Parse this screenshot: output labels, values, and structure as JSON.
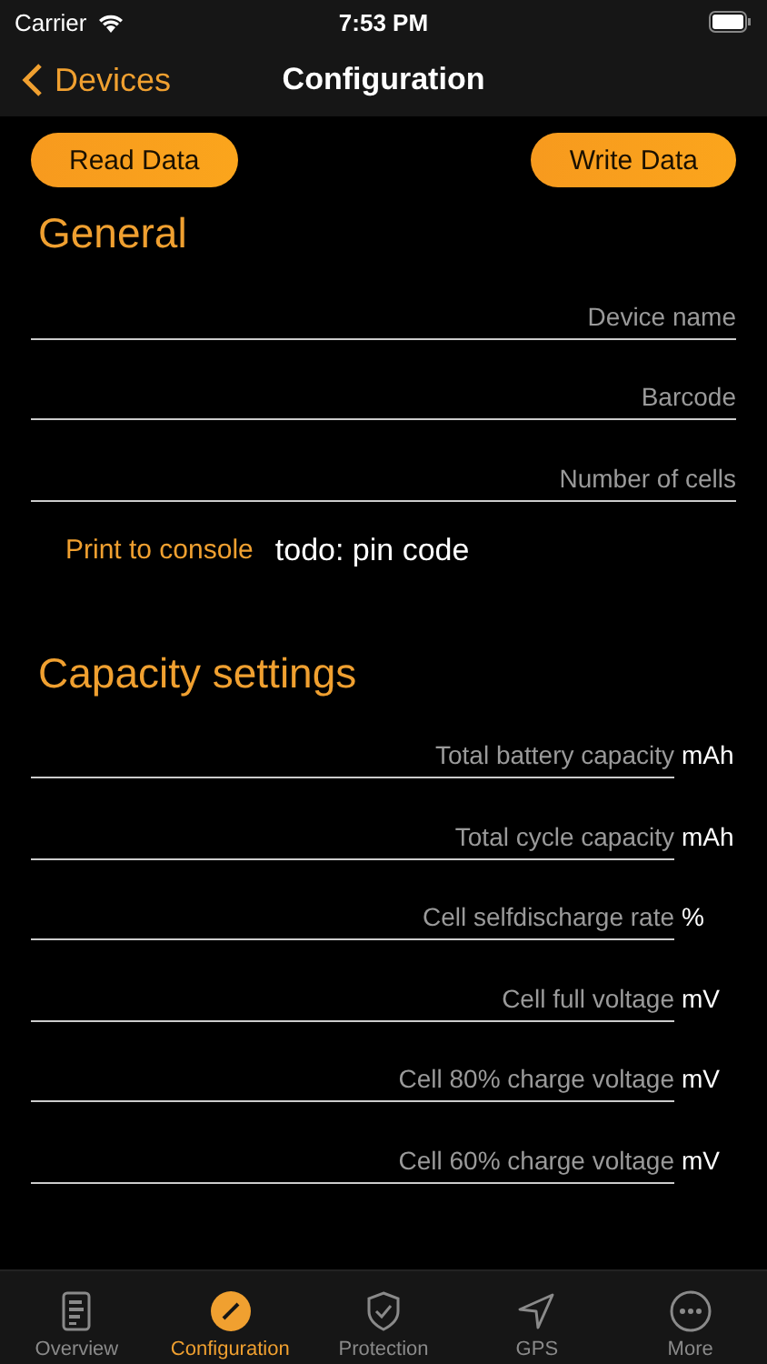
{
  "status_bar": {
    "carrier": "Carrier",
    "time": "7:53 PM"
  },
  "nav": {
    "back": "Devices",
    "title": "Configuration"
  },
  "actions": [
    "Read Data",
    "Write Data"
  ],
  "general": {
    "title": "General",
    "fields": [
      {
        "placeholder": "Device name"
      },
      {
        "placeholder": "Barcode"
      },
      {
        "placeholder": "Number of cells"
      }
    ],
    "console_link": "Print to console",
    "note": "todo: pin code"
  },
  "capacity": {
    "title": "Capacity settings",
    "fields": [
      {
        "placeholder": "Total battery capacity",
        "unit": "mAh"
      },
      {
        "placeholder": "Total cycle capacity",
        "unit": "mAh"
      },
      {
        "placeholder": "Cell selfdischarge rate",
        "unit": "%"
      },
      {
        "placeholder": "Cell full voltage",
        "unit": "mV"
      },
      {
        "placeholder": "Cell 80% charge voltage",
        "unit": "mV"
      },
      {
        "placeholder": "Cell 60% charge voltage",
        "unit": "mV"
      }
    ]
  },
  "tabs": [
    {
      "label": "Overview",
      "kind": "doc",
      "selected": false
    },
    {
      "label": "Configuration",
      "kind": "pencil",
      "selected": true
    },
    {
      "label": "Protection",
      "kind": "shield",
      "selected": false
    },
    {
      "label": "GPS",
      "kind": "arrow",
      "selected": false
    },
    {
      "label": "More",
      "kind": "more",
      "selected": false
    }
  ]
}
